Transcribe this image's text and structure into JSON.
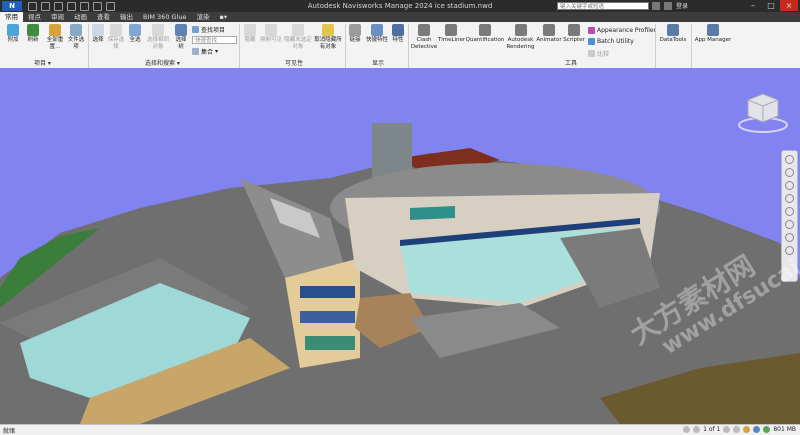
{
  "app": {
    "title": "Autodesk Navisworks Manage 2024    ice stadium.nwd",
    "app_button": "N",
    "search_placeholder": "键入关键字或短语",
    "sign_in": "登录"
  },
  "tabs": [
    {
      "label": "常用",
      "active": true
    },
    {
      "label": "视点"
    },
    {
      "label": "审阅"
    },
    {
      "label": "动画"
    },
    {
      "label": "查看"
    },
    {
      "label": "输出"
    },
    {
      "label": "BIM 360 Glue"
    },
    {
      "label": "渲染"
    }
  ],
  "ribbon": {
    "project": {
      "label": "项目",
      "tools": [
        "附加",
        "刷新",
        "全部重置...",
        "文件选项"
      ]
    },
    "select": {
      "label": "选择和搜索",
      "tools": [
        "选择",
        "保存选择",
        "全选",
        "选择相同对象",
        "选择树"
      ],
      "find_items": "查找项目",
      "quick_find_placeholder": "快速查找",
      "sets_dropdown": "集合"
    },
    "visibility": {
      "label": "可见性",
      "tools": [
        "隐藏",
        "强制可见",
        "隐藏未选定对象",
        "取消隐藏所有对象"
      ]
    },
    "display": {
      "label": "显示",
      "tools": [
        "链接",
        "快捷特性",
        "特性"
      ]
    },
    "tools": {
      "label": "工具",
      "items": [
        "Clash Detective",
        "TimeLiner",
        "Quantification",
        "Autodesk Rendering",
        "Animator",
        "Scripter"
      ],
      "small": [
        "Appearance Profiler",
        "Batch Utility",
        "比较"
      ]
    },
    "datatools": "DataTools",
    "appmanager": "App Manager"
  },
  "status": {
    "left": "就绪",
    "page": "1 of 1",
    "memory": "801 MB"
  },
  "watermark": {
    "line1": "大方素材网",
    "line2": "www.dfsucai.com"
  },
  "colors": {
    "sky": "#8183f0",
    "titlebar": "#2b2b2b",
    "ribbon": "#f3f3f3",
    "roof": "#8d8d8d",
    "glass": "#9fd9d7",
    "wall": "#d8c39a"
  }
}
